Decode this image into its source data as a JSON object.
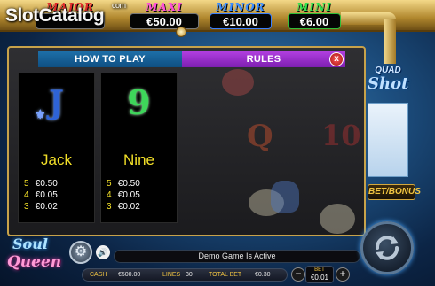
{
  "watermark": {
    "text": "SlotCatalog",
    "suffix": "com"
  },
  "jackpots": [
    {
      "label": "MAJOR",
      "value": ""
    },
    {
      "label": "MAXI",
      "value": "€50.00"
    },
    {
      "label": "MINOR",
      "value": "€10.00"
    },
    {
      "label": "MINI",
      "value": "€6.00"
    }
  ],
  "paytable": {
    "tabs": {
      "how_to_play": "HOW TO PLAY",
      "rules": "RULES"
    },
    "close_label": "x",
    "cards": [
      {
        "symbol": "J",
        "name": "Jack",
        "pays": [
          {
            "count": "5",
            "amount": "€0.50"
          },
          {
            "count": "4",
            "amount": "€0.05"
          },
          {
            "count": "3",
            "amount": "€0.02"
          }
        ]
      },
      {
        "symbol": "9",
        "name": "Nine",
        "pays": [
          {
            "count": "5",
            "amount": "€0.50"
          },
          {
            "count": "4",
            "amount": "€0.05"
          },
          {
            "count": "3",
            "amount": "€0.02"
          }
        ]
      }
    ]
  },
  "reels_background": {
    "symbols": [
      "Q",
      "10"
    ]
  },
  "side": {
    "logo_top": "QUAD",
    "logo_bottom": "Shot",
    "bet_bonus_label": "BET/BONUS"
  },
  "game_logo": {
    "top": "Soul",
    "bottom": "Queen"
  },
  "status": {
    "message": "Demo Game Is Active"
  },
  "info": {
    "cash_label": "CASH",
    "cash_value": "€500.00",
    "lines_label": "LINES",
    "lines_value": "30",
    "total_bet_label": "TOTAL BET",
    "total_bet_value": "€0.30"
  },
  "bet": {
    "label": "BET",
    "value": "€0.01",
    "minus": "−",
    "plus": "+"
  },
  "icons": {
    "gear": "gear-icon",
    "sound": "speaker-icon",
    "spin": "spin-arrows-icon",
    "close": "close-icon",
    "fleur": "fleur-de-lis-icon"
  },
  "colors": {
    "major": "#e02a2a",
    "maxi": "#ff4fd8",
    "minor": "#3a8cff",
    "mini": "#2fe04c",
    "tab_how": "#1d6fa8",
    "tab_rules": "#b13fe0",
    "pay_text": "#f2df28"
  }
}
